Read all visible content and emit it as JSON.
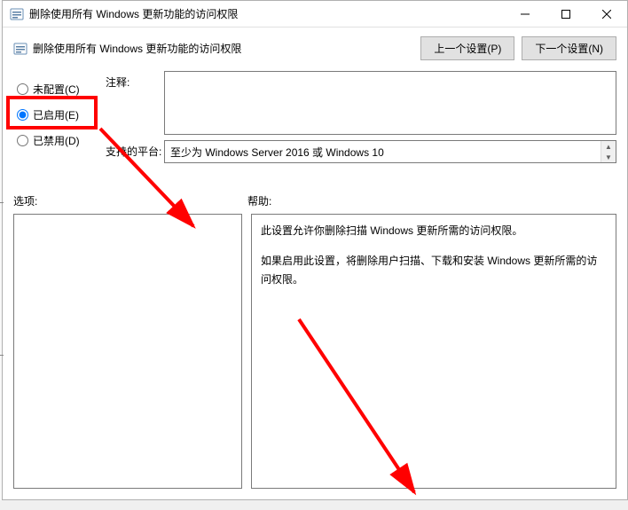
{
  "window": {
    "title": "删除使用所有 Windows 更新功能的访问权限"
  },
  "header": {
    "title": "删除使用所有 Windows 更新功能的访问权限"
  },
  "nav": {
    "prev": "上一个设置(P)",
    "next": "下一个设置(N)"
  },
  "radios": {
    "not_configured": "未配置(C)",
    "enabled": "已启用(E)",
    "disabled": "已禁用(D)"
  },
  "fields": {
    "comment_label": "注释:",
    "comment_value": "",
    "platform_label": "支持的平台:",
    "platform_value": "至少为 Windows Server 2016 或 Windows 10"
  },
  "sections": {
    "options": "选项:",
    "help": "帮助:"
  },
  "help": {
    "p1": "此设置允许你删除扫描 Windows 更新所需的访问权限。",
    "p2": "如果启用此设置，将删除用户扫描、下载和安装 Windows 更新所需的访问权限。"
  }
}
